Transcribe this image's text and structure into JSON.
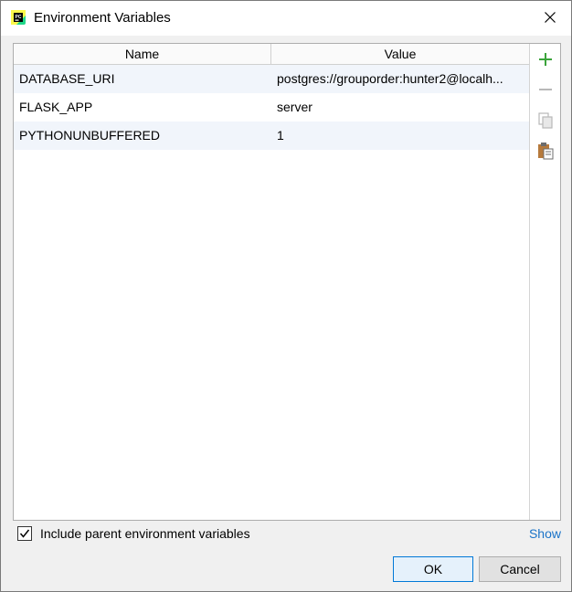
{
  "window": {
    "title": "Environment Variables"
  },
  "table": {
    "headers": [
      "Name",
      "Value"
    ],
    "rows": [
      {
        "name": "DATABASE_URI",
        "value": "postgres://grouporder:hunter2@localh..."
      },
      {
        "name": "FLASK_APP",
        "value": "server"
      },
      {
        "name": "PYTHONUNBUFFERED",
        "value": "1"
      }
    ]
  },
  "toolbar": {
    "icons": [
      "add-icon",
      "remove-icon",
      "copy-icon",
      "paste-icon"
    ],
    "colors": {
      "add": "#3aa33a",
      "disabled": "#b8b8b8",
      "paste": "#b67a3c"
    }
  },
  "options": {
    "include_parent_label": "Include parent environment variables",
    "include_parent_checked": true,
    "show_label": "Show"
  },
  "buttons": {
    "ok": "OK",
    "cancel": "Cancel"
  },
  "colors": {
    "accent": "#0078d7",
    "link": "#1a73c8",
    "row_alt": "#f1f5fb"
  }
}
